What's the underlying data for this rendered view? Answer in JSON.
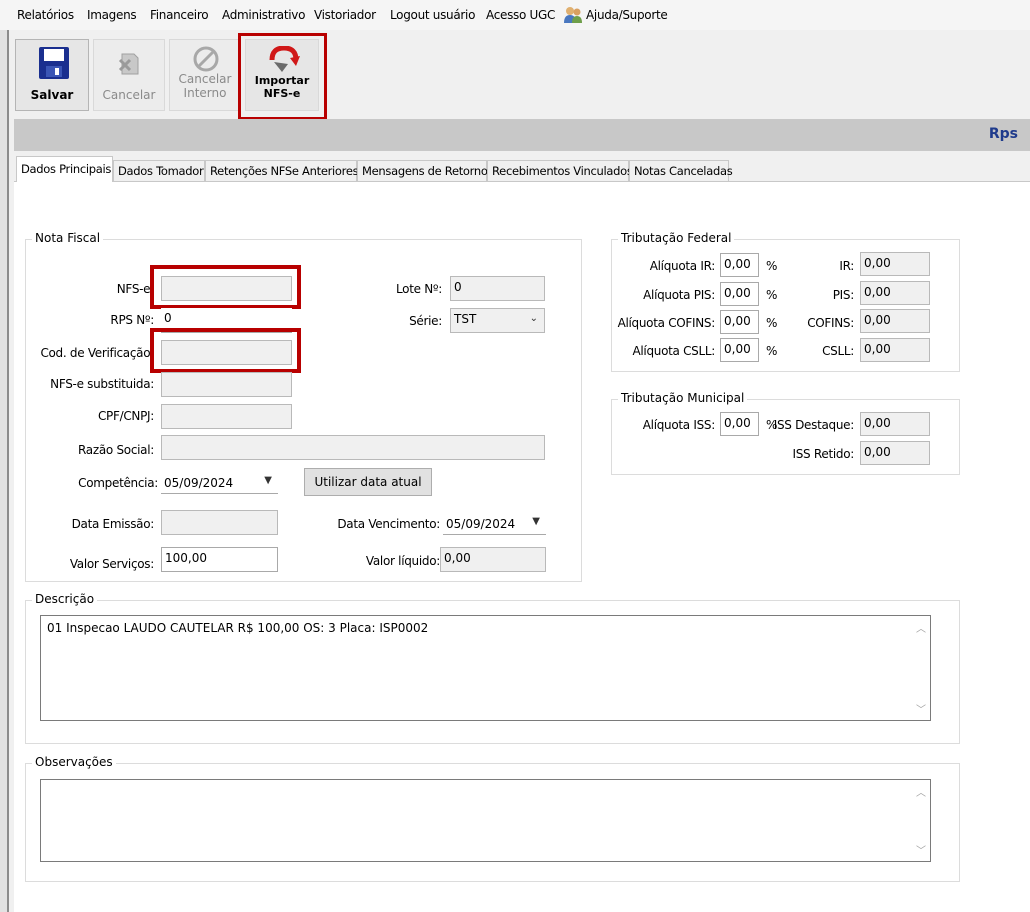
{
  "menu": {
    "items": [
      "Relatórios",
      "Imagens",
      "Financeiro",
      "Administrativo",
      "Vistoriador",
      "Logout usuário",
      "Acesso UGC",
      "Ajuda/Suporte"
    ]
  },
  "toolbar": {
    "save_label": "Salvar",
    "cancel_label": "Cancelar",
    "cancel_internal_label": "Cancelar Interno",
    "import_label": "Importar NFS-e"
  },
  "header": {
    "title": "Rps"
  },
  "tabs": [
    "Dados Principais",
    "Dados Tomador",
    "Retenções NFSe Anteriores",
    "Mensagens de Retorno",
    "Recebimentos Vinculados",
    "Notas Canceladas"
  ],
  "nota_fiscal": {
    "title": "Nota Fiscal",
    "nfse_label": "NFS-e:",
    "nfse_value": "",
    "rps_label": "RPS Nº:",
    "rps_value": "0",
    "cod_verif_label": "Cod. de Verificação:",
    "cod_verif_value": "",
    "nfse_subst_label": "NFS-e substituida:",
    "nfse_subst_value": "",
    "cpf_label": "CPF/CNPJ:",
    "cpf_value": "",
    "razao_label": "Razão Social:",
    "razao_value": "",
    "competencia_label": "Competência:",
    "competencia_value": "05/09/2024",
    "usar_data_button": "Utilizar data atual",
    "data_emissao_label": "Data Emissão:",
    "data_emissao_value": "",
    "valor_servicos_label": "Valor Serviços:",
    "valor_servicos_value": "100,00",
    "lote_label": "Lote Nº:",
    "lote_value": "0",
    "serie_label": "Série:",
    "serie_value": "TST",
    "data_venc_label": "Data Vencimento:",
    "data_venc_value": "05/09/2024",
    "valor_liquido_label": "Valor líquido:",
    "valor_liquido_value": "0,00"
  },
  "trib_federal": {
    "title": "Tributação Federal",
    "rows": [
      {
        "aliq_label": "Alíquota IR:",
        "aliq_value": "0,00",
        "pct": "%",
        "val_label": "IR:",
        "val_value": "0,00"
      },
      {
        "aliq_label": "Alíquota PIS:",
        "aliq_value": "0,00",
        "pct": "%",
        "val_label": "PIS:",
        "val_value": "0,00"
      },
      {
        "aliq_label": "Alíquota COFINS:",
        "aliq_value": "0,00",
        "pct": "%",
        "val_label": "COFINS:",
        "val_value": "0,00"
      },
      {
        "aliq_label": "Alíquota CSLL:",
        "aliq_value": "0,00",
        "pct": "%",
        "val_label": "CSLL:",
        "val_value": "0,00"
      }
    ]
  },
  "trib_municipal": {
    "title": "Tributação Municipal",
    "aliq_iss_label": "Alíquota ISS:",
    "aliq_iss_value": "0,00",
    "pct": "%",
    "iss_destaque_label": "ISS Destaque:",
    "iss_destaque_value": "0,00",
    "iss_retido_label": "ISS Retido:",
    "iss_retido_value": "0,00"
  },
  "descricao": {
    "title": "Descrição",
    "text": "01 Inspecao LAUDO CAUTELAR R$ 100,00 OS: 3 Placa: ISP0002"
  },
  "observacoes": {
    "title": "Observações",
    "text": ""
  }
}
